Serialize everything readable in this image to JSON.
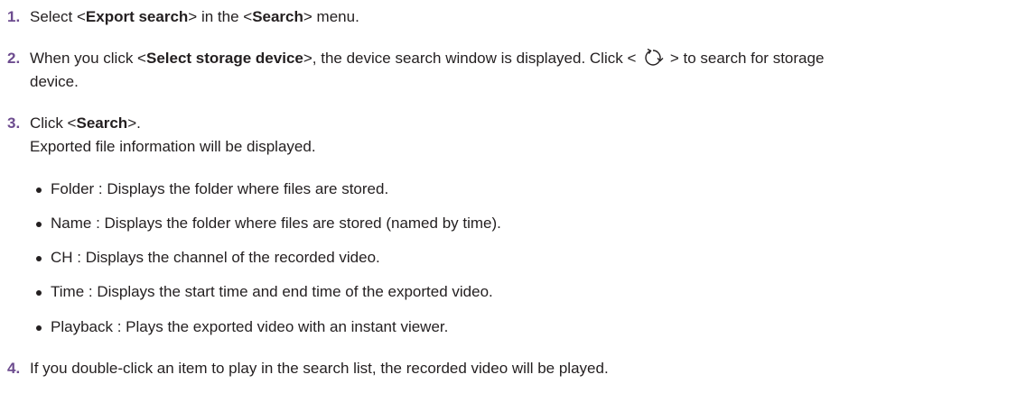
{
  "steps": [
    {
      "number": "1.",
      "parts": {
        "a": "Select <",
        "b": "Export search",
        "c": "> in the <",
        "d": "Search",
        "e": "> menu."
      }
    },
    {
      "number": "2.",
      "parts": {
        "a": "When you click <",
        "b": "Select storage device",
        "c": ">, the device search window is displayed. Click < ",
        "icon": "refresh-icon",
        "d": " > to search for storage",
        "e": "device."
      }
    },
    {
      "number": "3.",
      "parts": {
        "a": "Click <",
        "b": "Search",
        "c": ">.",
        "d": "Exported file information will be displayed."
      }
    },
    {
      "number": "4.",
      "parts": {
        "a": "If you double-click an item to play in the search list, the recorded video will be played."
      }
    }
  ],
  "bullets": [
    "Folder : Displays the folder where files are stored.",
    "Name : Displays the folder where files are stored (named by time).",
    "CH : Displays the channel of the recorded video.",
    "Time : Displays the start time and end time of the exported video.",
    "Playback : Plays the exported video with an instant viewer."
  ],
  "colors": {
    "step_number": "#6d4c8f",
    "text": "#231f20"
  }
}
